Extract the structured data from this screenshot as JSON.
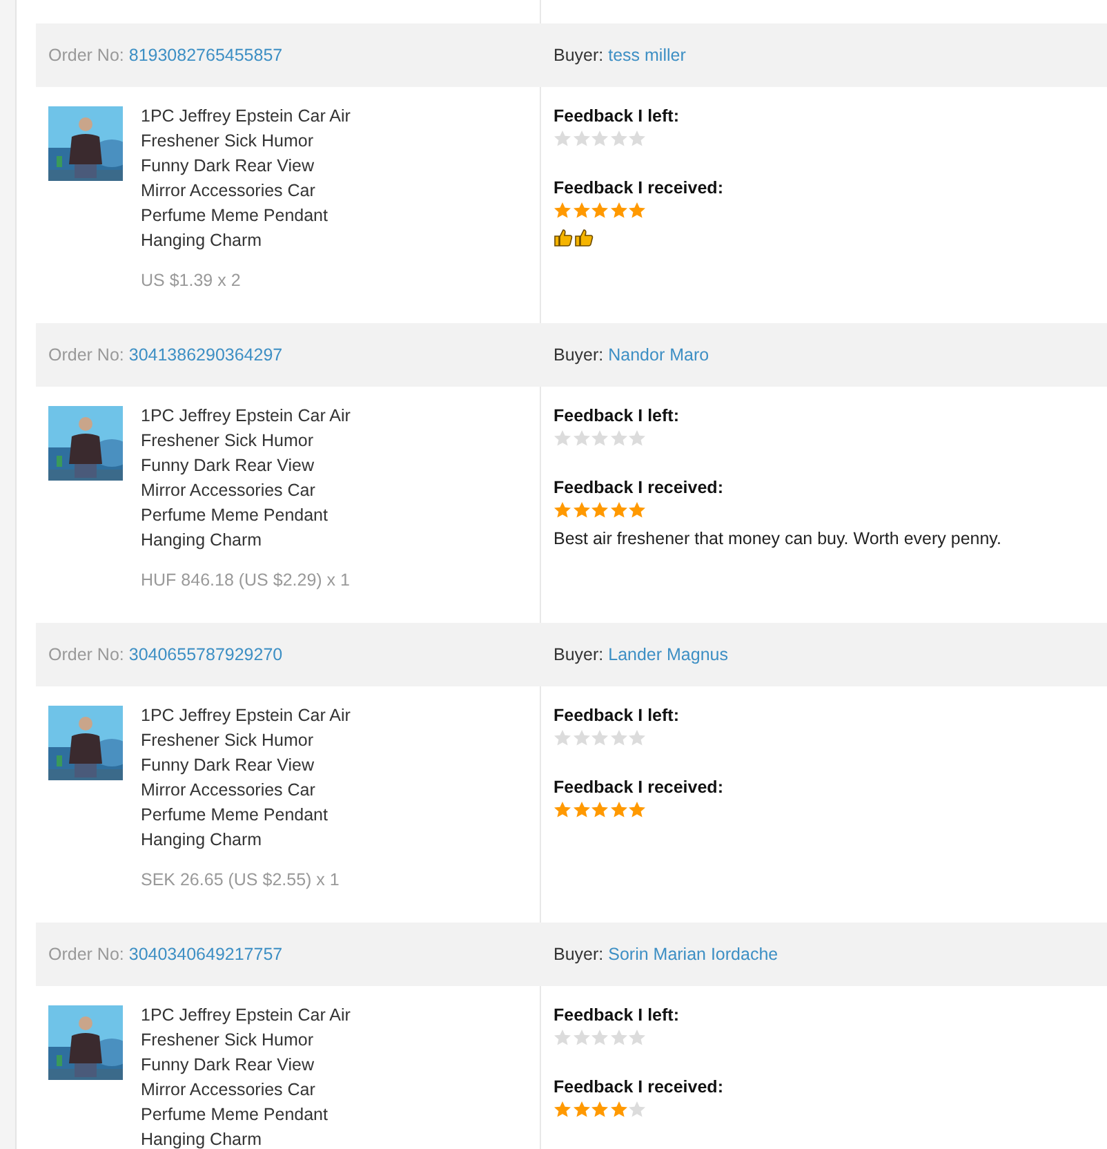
{
  "orders": [
    {
      "order_label": "Order No:",
      "order_no": "8193082765455857",
      "buyer_label": "Buyer:",
      "buyer": "tess miller",
      "product": "1PC Jeffrey Epstein Car Air Freshener Sick Humor Funny Dark Rear View Mirror Accessories Car Perfume Meme Pendant Hanging Charm",
      "price": "US $1.39 x 2",
      "left": {
        "label": "Feedback I left:",
        "stars": 0
      },
      "received": {
        "label": "Feedback I received:",
        "stars": 5
      },
      "comment": {
        "kind": "thumbs"
      }
    },
    {
      "order_label": "Order No:",
      "order_no": "3041386290364297",
      "buyer_label": "Buyer:",
      "buyer": "Nandor Maro",
      "product": "1PC Jeffrey Epstein Car Air Freshener Sick Humor Funny Dark Rear View Mirror Accessories Car Perfume Meme Pendant Hanging Charm",
      "price": "HUF 846.18 (US $2.29) x 1",
      "left": {
        "label": "Feedback I left:",
        "stars": 0
      },
      "received": {
        "label": "Feedback I received:",
        "stars": 5
      },
      "comment": {
        "kind": "text",
        "text": "Best air freshener that money can buy. Worth every penny."
      }
    },
    {
      "order_label": "Order No:",
      "order_no": "3040655787929270",
      "buyer_label": "Buyer:",
      "buyer": "Lander Magnus",
      "product": "1PC Jeffrey Epstein Car Air Freshener Sick Humor Funny Dark Rear View Mirror Accessories Car Perfume Meme Pendant Hanging Charm",
      "price": "SEK 26.65 (US $2.55) x 1",
      "left": {
        "label": "Feedback I left:",
        "stars": 0
      },
      "received": {
        "label": "Feedback I received:",
        "stars": 5
      }
    },
    {
      "order_label": "Order No:",
      "order_no": "3040340649217757",
      "buyer_label": "Buyer:",
      "buyer": "Sorin Marian Iordache",
      "product": "1PC Jeffrey Epstein Car Air Freshener Sick Humor Funny Dark Rear View Mirror Accessories Car Perfume Meme Pendant Hanging Charm",
      "left": {
        "label": "Feedback I left:",
        "stars": 0
      },
      "received": {
        "label": "Feedback I received:",
        "stars": 4
      }
    }
  ]
}
